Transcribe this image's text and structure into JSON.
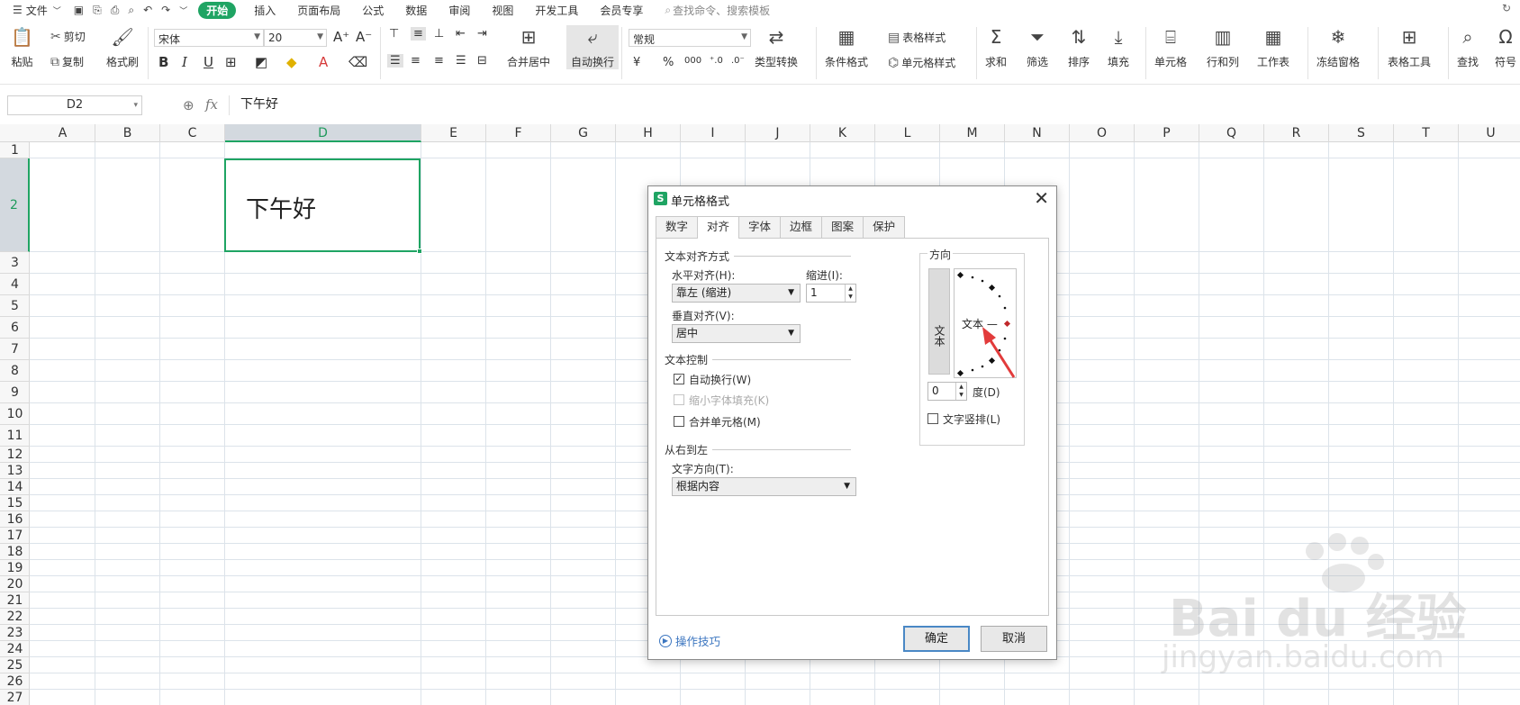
{
  "menu": {
    "file": "文件",
    "tabs": [
      "开始",
      "插入",
      "页面布局",
      "公式",
      "数据",
      "审阅",
      "视图",
      "开发工具",
      "会员专享"
    ],
    "search_placeholder": "查找命令、搜索模板"
  },
  "ribbon": {
    "paste": "粘贴",
    "cut": "剪切",
    "copy": "复制",
    "format_painter": "格式刷",
    "font_name": "宋体",
    "font_size": "20",
    "merge_center": "合并居中",
    "wrap_text": "自动换行",
    "number_format": "常规",
    "type_convert": "类型转换",
    "conditional_format": "条件格式",
    "table_style": "表格样式",
    "cell_style": "单元格样式",
    "sum": "求和",
    "filter": "筛选",
    "sort": "排序",
    "fill": "填充",
    "cell": "单元格",
    "row_col": "行和列",
    "worksheet": "工作表",
    "freeze": "冻结窗格",
    "table_tools": "表格工具",
    "find": "查找",
    "symbol": "符号",
    "currency": "¥",
    "percent": "%",
    "thousands": "000"
  },
  "formula_bar": {
    "name_box": "D2",
    "fx": "fx",
    "content": "下午好"
  },
  "grid": {
    "columns": [
      "A",
      "B",
      "C",
      "D",
      "E",
      "F",
      "G",
      "H",
      "I",
      "J",
      "K",
      "L",
      "M",
      "N",
      "O",
      "P",
      "Q",
      "R",
      "S",
      "T",
      "U"
    ],
    "rows": [
      "1",
      "2",
      "3",
      "4",
      "5",
      "6",
      "7",
      "8",
      "9",
      "10",
      "11",
      "12",
      "13",
      "14",
      "15",
      "16",
      "17",
      "18",
      "19",
      "20",
      "21",
      "22",
      "23",
      "24",
      "25",
      "26",
      "27"
    ],
    "selected_column": "D",
    "selected_row": "2",
    "cell_value": "下午好"
  },
  "dialog": {
    "title": "单元格格式",
    "tabs": [
      "数字",
      "对齐",
      "字体",
      "边框",
      "图案",
      "保护"
    ],
    "active_tab": "对齐",
    "text_alignment_group": "文本对齐方式",
    "horizontal_label": "水平对齐(H):",
    "horizontal_value": "靠左 (缩进)",
    "indent_label": "缩进(I):",
    "indent_value": "1",
    "vertical_label": "垂直对齐(V):",
    "vertical_value": "居中",
    "text_control_group": "文本控制",
    "wrap_text": "自动换行(W)",
    "wrap_text_checked": true,
    "shrink_to_fit": "缩小字体填充(K)",
    "merge_cells": "合并单元格(M)",
    "rtl_group": "从右到左",
    "text_direction_label": "文字方向(T):",
    "text_direction_value": "根据内容",
    "orientation_group": "方向",
    "orientation_vertical_text": "文本",
    "orientation_dial_text": "文本 —",
    "degree_value": "0",
    "degree_label": "度(D)",
    "vertical_text": "文字竖排(L)",
    "tips": "操作技巧",
    "ok": "确定",
    "cancel": "取消"
  },
  "watermark": {
    "brand": "Bai  du 经验",
    "url": "jingyan.baidu.com"
  },
  "colors": {
    "accent": "#1fa463",
    "selection_header": "#d3d9df",
    "grid_line": "#dce3ea",
    "arrow_annotation": "#e23b3b",
    "link": "#3c76c0"
  }
}
